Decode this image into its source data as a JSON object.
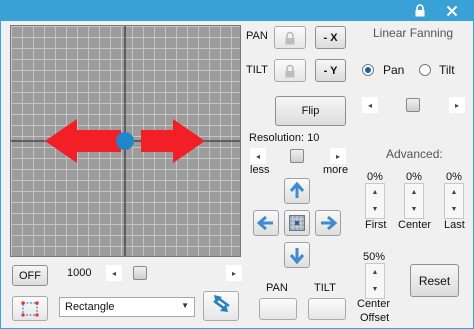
{
  "colors": {
    "titlebar": "#3aa1d6",
    "accent": "#2a7fbf",
    "arrow_red": "#f21f27",
    "center_dot": "#1f86c9"
  },
  "left": {
    "off_button": "OFF",
    "speed_value": "1000",
    "shape_select": {
      "value": "Rectangle"
    }
  },
  "middle": {
    "pan_label": "PAN",
    "tilt_label": "TILT",
    "invert_x_button": "- X",
    "invert_y_button": "- Y",
    "flip_button": "Flip",
    "resolution_label": "Resolution:",
    "resolution_value": "10",
    "less_label": "less",
    "more_label": "more",
    "pan_bottom_label": "PAN",
    "tilt_bottom_label": "TILT"
  },
  "right": {
    "title": "Linear Fanning",
    "pan_option": "Pan",
    "tilt_option": "Tilt",
    "selected_option": "Pan",
    "advanced_label": "Advanced:",
    "first_pct": "0%",
    "center_pct": "0%",
    "last_pct": "0%",
    "first_label": "First",
    "center_label": "Center",
    "last_label": "Last",
    "center_offset_pct": "50%",
    "center_offset_label_line1": "Center",
    "center_offset_label_line2": "Offset",
    "reset_button": "Reset"
  }
}
